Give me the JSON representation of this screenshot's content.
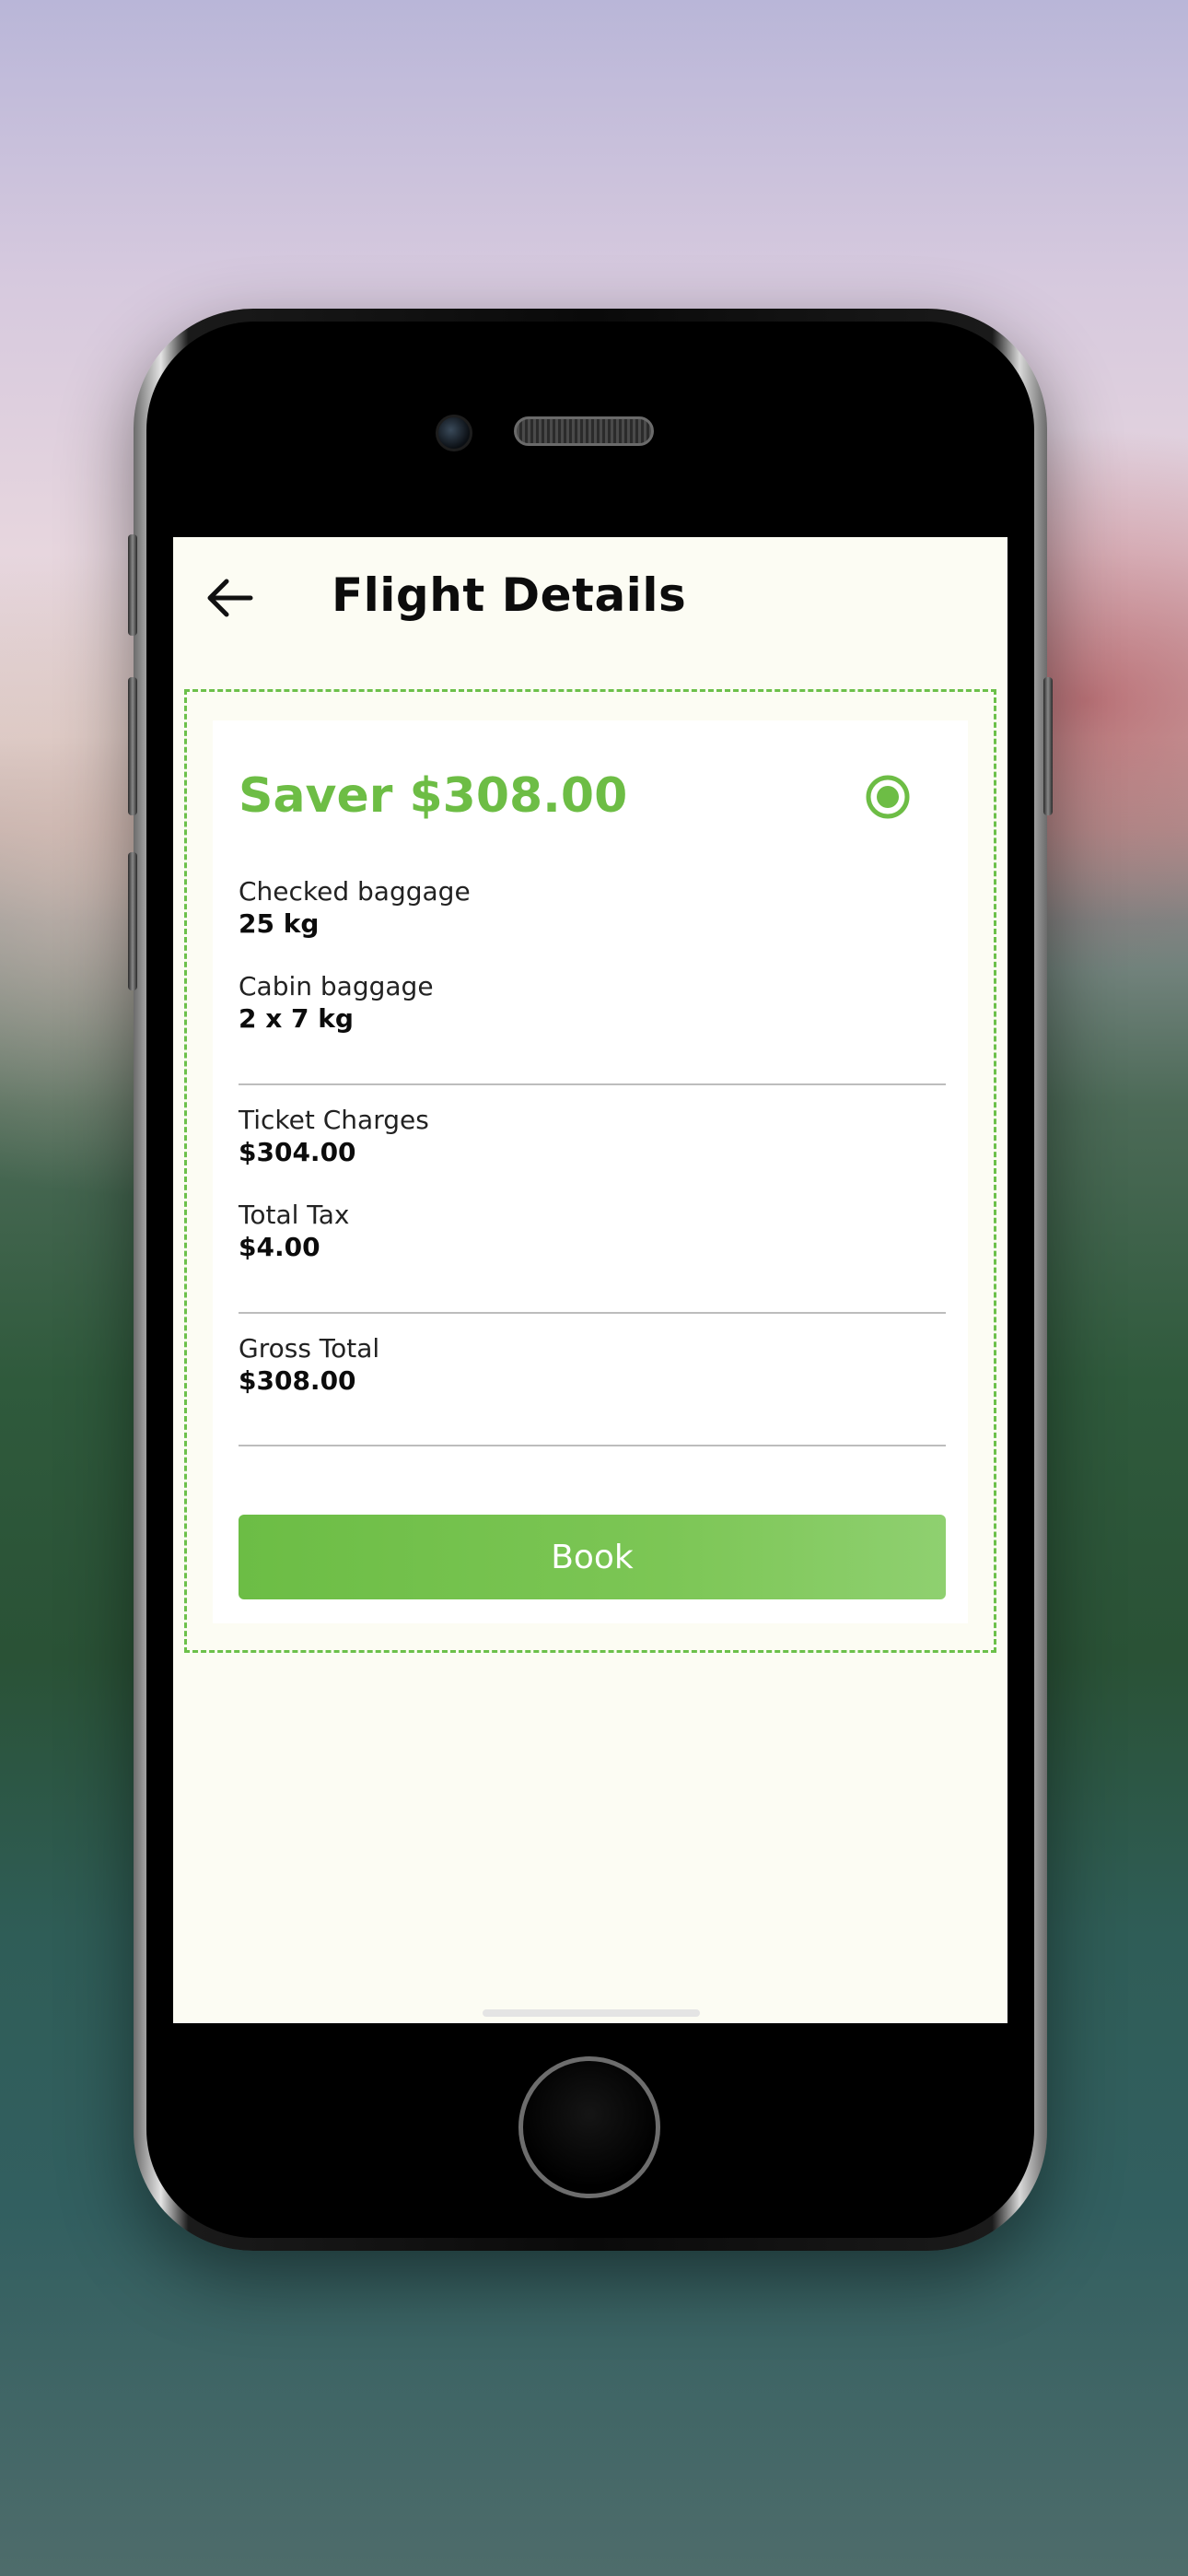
{
  "header": {
    "back_icon": "arrow-left-icon",
    "title": "Flight Details"
  },
  "fare": {
    "title": "Saver $308.00",
    "selected": true,
    "radio_icon": "radio-selected-icon",
    "accent_color": "#6dbd45",
    "details": [
      {
        "label": "Checked baggage",
        "value": "25 kg"
      },
      {
        "label": "Cabin baggage",
        "value": "2 x 7 kg"
      }
    ],
    "charges": [
      {
        "label": "Ticket Charges",
        "value": "$304.00"
      },
      {
        "label": "Total Tax",
        "value": "$4.00"
      }
    ],
    "total": {
      "label": "Gross Total",
      "value": "$308.00"
    },
    "book_label": "Book"
  }
}
